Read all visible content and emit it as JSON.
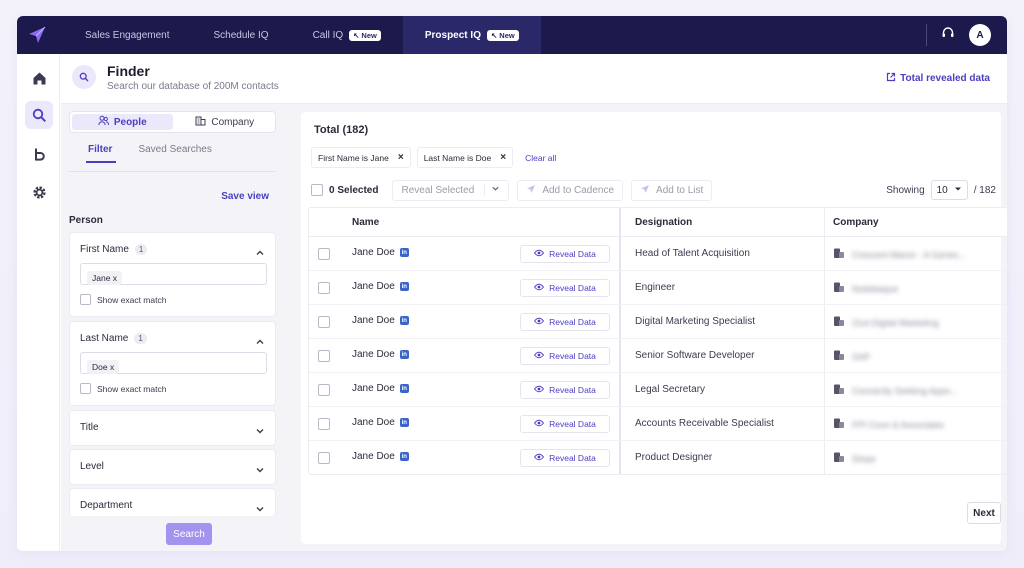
{
  "colors": {
    "nav_bg": "#1c1a4c",
    "nav_active": "#2a2868",
    "accent": "#4b3fc0",
    "search_btn": "#a392ee"
  },
  "nav": {
    "tabs": [
      {
        "label": "Sales Engagement",
        "new": false,
        "active": false
      },
      {
        "label": "Schedule IQ",
        "new": false,
        "active": false
      },
      {
        "label": "Call IQ",
        "new": true,
        "active": false
      },
      {
        "label": "Prospect IQ",
        "new": true,
        "active": true
      }
    ],
    "new_badge": "New",
    "avatar_initial": "A",
    "icons": {
      "logo": "paper-plane-logo",
      "support": "headset-icon"
    }
  },
  "rail": {
    "items": [
      "home-icon",
      "search-icon",
      "bullhorn-icon",
      "settings-icon"
    ],
    "active": "search-icon"
  },
  "header": {
    "title": "Finder",
    "subtitle": "Search our database of 200M contacts",
    "revealed_link": "Total revealed data"
  },
  "filter": {
    "segment": {
      "people": "People",
      "company": "Company",
      "active": "People"
    },
    "tabs": {
      "filter": "Filter",
      "saved": "Saved Searches",
      "active": "Filter"
    },
    "save_view": "Save view",
    "section": "Person",
    "first_name": {
      "label": "First Name",
      "count": "1",
      "chip": "Jane x",
      "exact": "Show exact match"
    },
    "last_name": {
      "label": "Last Name",
      "count": "1",
      "chip": "Doe x",
      "exact": "Show exact match"
    },
    "collapsed": {
      "title": "Title",
      "level": "Level",
      "department": "Department"
    },
    "search_button": "Search"
  },
  "results": {
    "total": "Total (182)",
    "applied": [
      {
        "label": "First Name is Jane"
      },
      {
        "label": "Last Name is Doe"
      }
    ],
    "clear_all": "Clear all",
    "toolbar": {
      "selected": "0 Selected",
      "reveal_selected": "Reveal Selected",
      "add_to_cadence": "Add to Cadence",
      "add_to_list": "Add to List",
      "showing": "Showing",
      "page_size": "10",
      "of_total": "/ 182"
    },
    "columns": {
      "name": "Name",
      "designation": "Designation",
      "company": "Company"
    },
    "reveal_label": "Reveal Data",
    "rows": [
      {
        "name": "Jane Doe",
        "designation": "Head of Talent Acquisition",
        "company": "Crescent Manor - A Genes..."
      },
      {
        "name": "Jane Doe",
        "designation": "Engineer",
        "company": "Noteleaque"
      },
      {
        "name": "Jane Doe",
        "designation": "Digital Marketing Specialist",
        "company": "21st Digital Marketing"
      },
      {
        "name": "Jane Doe",
        "designation": "Senior Software Developer",
        "company": "SAP"
      },
      {
        "name": "Jane Doe",
        "designation": "Legal Secretary",
        "company": "Connectly Seeking Appo..."
      },
      {
        "name": "Jane Doe",
        "designation": "Accounts Receivable Specialist",
        "company": "FPI Conn & Associates"
      },
      {
        "name": "Jane Doe",
        "designation": "Product Designer",
        "company": "Stripe"
      }
    ],
    "next": "Next"
  }
}
